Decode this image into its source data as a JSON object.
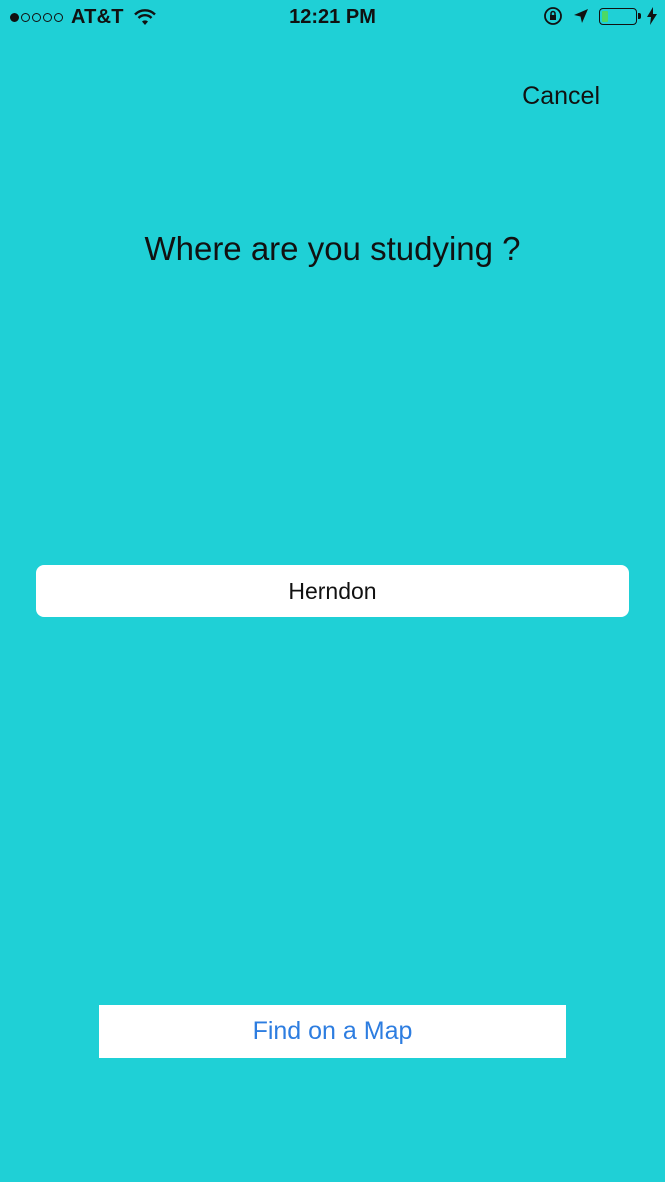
{
  "status_bar": {
    "carrier": "AT&T",
    "time": "12:21 PM",
    "signal_bars_filled": 1,
    "signal_bars_total": 5,
    "battery_level_fraction": 0.2,
    "icons": [
      "wifi-icon",
      "orientation-lock-icon",
      "location-arrow-icon",
      "battery-icon",
      "charging-bolt-icon"
    ]
  },
  "nav": {
    "cancel_label": "Cancel"
  },
  "main": {
    "title": "Where are you studying ?",
    "location_value": "Herndon",
    "find_map_label": "Find on a Map"
  },
  "colors": {
    "background": "#1fd0d6",
    "link_blue": "#2d7de0",
    "battery_green": "#4cd964"
  }
}
